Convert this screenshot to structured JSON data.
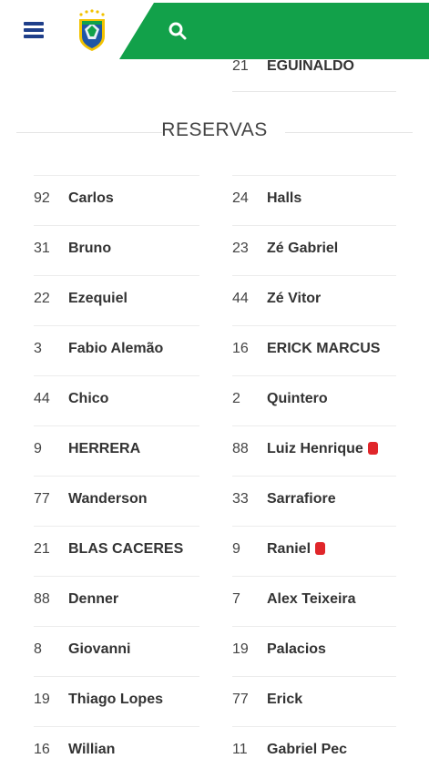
{
  "header": {
    "menu_icon": "hamburger-menu-icon",
    "logo_icon": "cbf-crest-logo",
    "search_icon": "search-icon",
    "brand_color": "#12a14a"
  },
  "previous_row": {
    "number": "21",
    "name": "EGUINALDO"
  },
  "section": {
    "title": "RESERVAS"
  },
  "reserves": {
    "left": [
      {
        "number": "92",
        "name": "Carlos"
      },
      {
        "number": "31",
        "name": "Bruno"
      },
      {
        "number": "22",
        "name": "Ezequiel"
      },
      {
        "number": "3",
        "name": "Fabio Alemão"
      },
      {
        "number": "44",
        "name": "Chico"
      },
      {
        "number": "9",
        "name": "HERRERA"
      },
      {
        "number": "77",
        "name": "Wanderson"
      },
      {
        "number": "21",
        "name": "BLAS CACERES"
      },
      {
        "number": "88",
        "name": "Denner"
      },
      {
        "number": "8",
        "name": "Giovanni"
      },
      {
        "number": "19",
        "name": "Thiago Lopes"
      },
      {
        "number": "16",
        "name": "Willian"
      }
    ],
    "right": [
      {
        "number": "24",
        "name": "Halls"
      },
      {
        "number": "23",
        "name": "Zé Gabriel"
      },
      {
        "number": "44",
        "name": "Zé Vitor"
      },
      {
        "number": "16",
        "name": "ERICK MARCUS"
      },
      {
        "number": "2",
        "name": "Quintero"
      },
      {
        "number": "88",
        "name": "Luiz Henrique",
        "red_card": true
      },
      {
        "number": "33",
        "name": "Sarrafiore"
      },
      {
        "number": "9",
        "name": "Raniel",
        "red_card": true
      },
      {
        "number": "7",
        "name": "Alex Teixeira"
      },
      {
        "number": "19",
        "name": "Palacios"
      },
      {
        "number": "77",
        "name": "Erick"
      },
      {
        "number": "11",
        "name": "Gabriel Pec"
      }
    ]
  },
  "card_color": "#e0262a"
}
